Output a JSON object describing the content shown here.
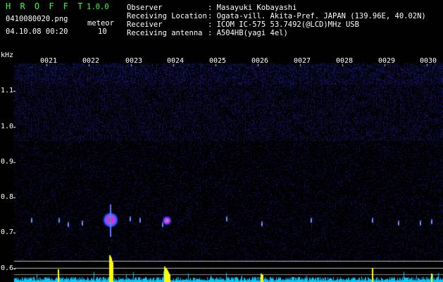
{
  "app": {
    "title": "H R O F F T",
    "version": "1.0.0"
  },
  "file": {
    "name": "0410080020.png",
    "timestamp": "04.10.08 00:20"
  },
  "meteor": {
    "label": "meteor",
    "count": "10"
  },
  "station": {
    "observer_label": "Observer",
    "observer_value": ": Masayuki Kobayashi",
    "location_label": "Receiving Location",
    "location_value": ": Ogata-vill. Akita-Pref. JAPAN (139.96E, 40.02N)",
    "receiver_label": "Receiver",
    "receiver_value": ": ICOM IC-575 53.7492(@LCD)MHz USB",
    "antenna_label": "Receiving antenna",
    "antenna_value": ": A504HB(yagi 4el)"
  },
  "axis": {
    "unit": "kHz",
    "freq_ticks": [
      "1.1",
      "1.0",
      "0.9",
      "0.8",
      "0.7",
      "0.6"
    ],
    "time_ticks": [
      "0021",
      "0022",
      "0023",
      "0024",
      "0025",
      "0026",
      "0027",
      "0028",
      "0029",
      "0030"
    ]
  },
  "colors": {
    "background": "#000000",
    "noise": "#1a1a8c",
    "meteor_core": "#ff2040",
    "meteor_halo": "#40c0ff",
    "header_green": "#33ff33",
    "power_yellow": "#ffff00",
    "power_cyan": "#00e0ff"
  }
}
